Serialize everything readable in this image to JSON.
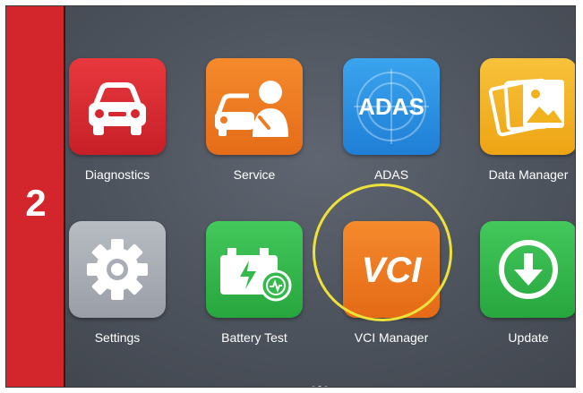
{
  "step": {
    "number": "2"
  },
  "apps": [
    {
      "label": "Diagnostics",
      "icon": "car-icon",
      "color": "#d8282f"
    },
    {
      "label": "Service",
      "icon": "mechanic-service-icon",
      "color": "#ee7a22"
    },
    {
      "label": "ADAS",
      "icon": "adas-icon",
      "icon_text": "ADAS",
      "color": "#2a8fe0"
    },
    {
      "label": "Data Manager",
      "icon": "photos-icon",
      "color": "#f2b21d"
    },
    {
      "label": "Settings",
      "icon": "gear-icon",
      "color": "#a9adb5"
    },
    {
      "label": "Battery Test",
      "icon": "battery-icon",
      "color": "#33b94c"
    },
    {
      "label": "VCI Manager",
      "icon": "vci-icon",
      "icon_text": "VCI",
      "color": "#ee7a22"
    },
    {
      "label": "Update",
      "icon": "download-arrow-icon",
      "color": "#33b94c"
    }
  ],
  "highlight": {
    "target": "VCI Manager",
    "color": "#eee23a"
  },
  "pager": {
    "pages": 3,
    "active": 2
  }
}
